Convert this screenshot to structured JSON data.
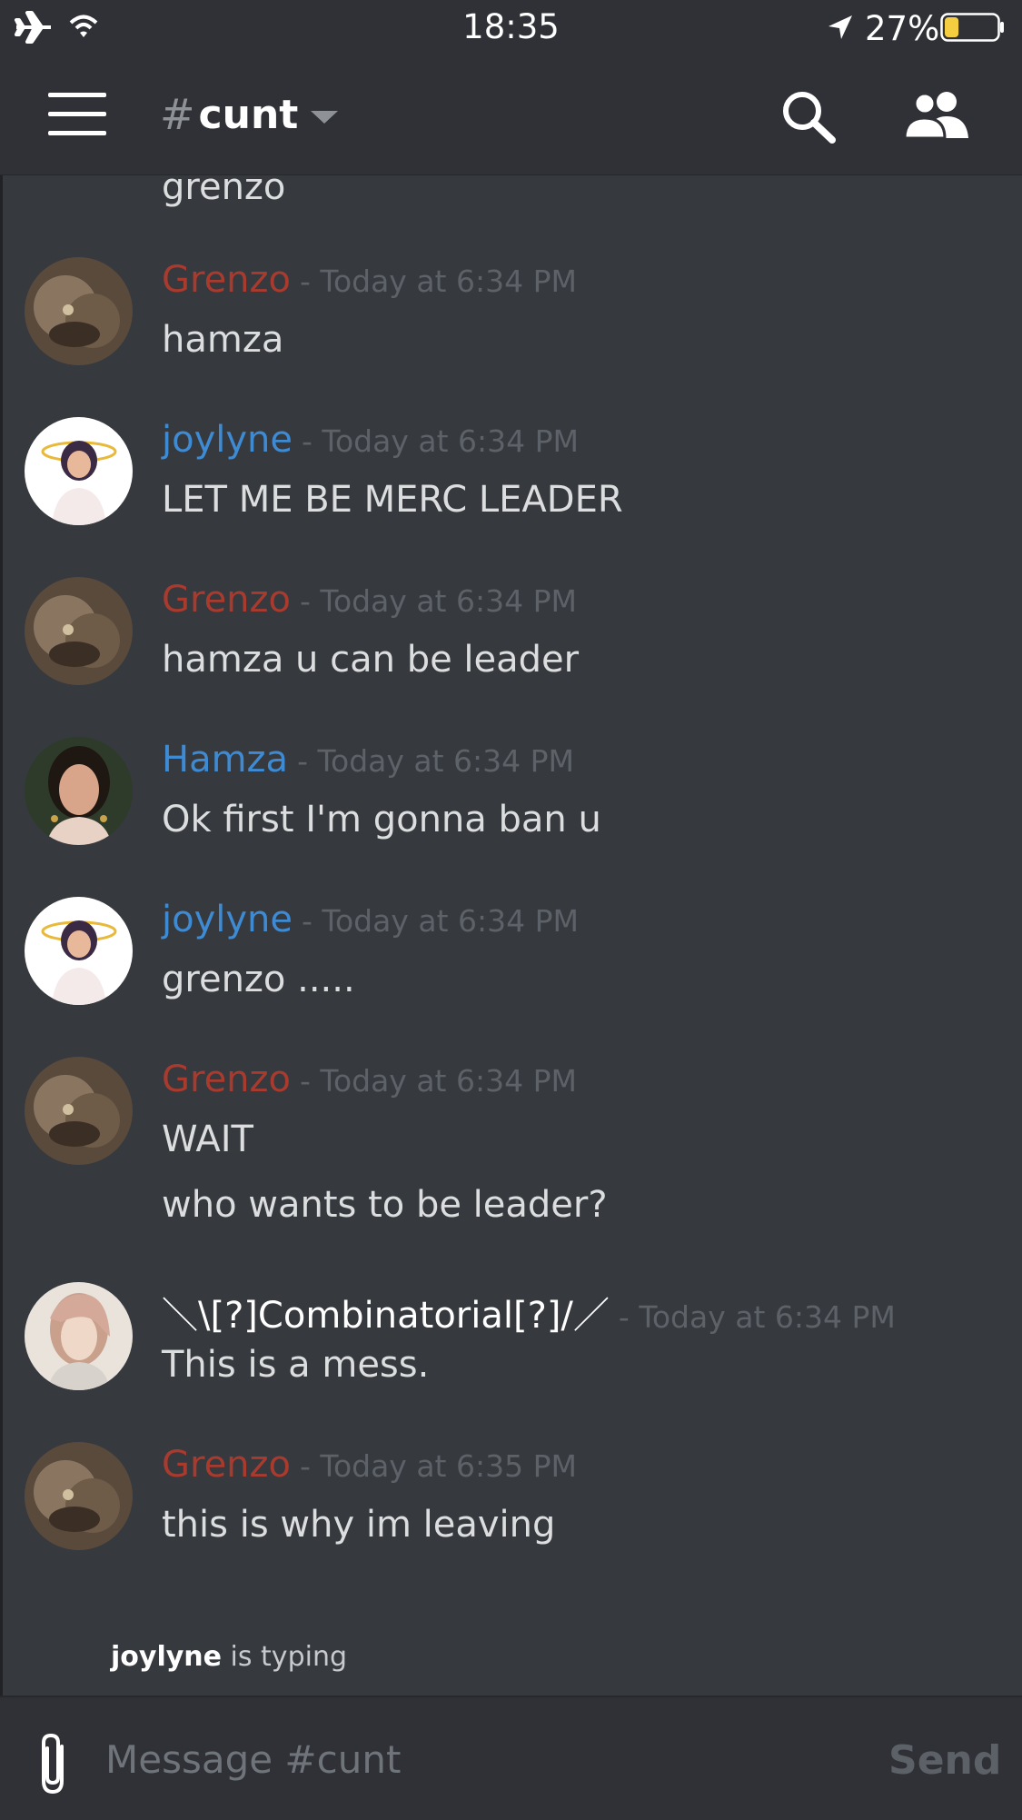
{
  "status_bar": {
    "time": "18:35",
    "battery_percent": "27%",
    "battery_level": 0.27
  },
  "header": {
    "channel_hash": "#",
    "channel_name": "cunt"
  },
  "colors": {
    "background": "#36393e",
    "bars": "#2f3136",
    "author_red": "#a83a2e",
    "author_blue": "#3e8bd3",
    "timestamp": "#5d6168",
    "text": "#dcddde"
  },
  "messages": {
    "partial": {
      "text": "grenzo"
    },
    "m1": {
      "author": "Grenzo",
      "time": "- Today at 6:34 PM",
      "text": "hamza"
    },
    "m2": {
      "author": "joylyne",
      "time": "- Today at 6:34 PM",
      "text": "LET ME BE MERC LEADER"
    },
    "m3": {
      "author": "Grenzo",
      "time": "- Today at 6:34 PM",
      "text": "hamza u can be leader"
    },
    "m4": {
      "author": "Hamza",
      "time": "- Today at 6:34 PM",
      "text": "Ok first I'm gonna ban u"
    },
    "m5": {
      "author": "joylyne",
      "time": "- Today at 6:34 PM",
      "text": "grenzo ....."
    },
    "m6": {
      "author": "Grenzo",
      "time": "- Today at 6:34 PM",
      "text": "WAIT",
      "text2": "who wants to be leader?"
    },
    "m7": {
      "author": "＼\\[?]Combinatorial[?]/／",
      "time": "- Today at 6:34 PM",
      "text": "This is a mess."
    },
    "m8": {
      "author": "Grenzo",
      "time": "- Today at 6:35 PM",
      "text": "this is why im leaving"
    }
  },
  "typing": {
    "user": "joylyne",
    "suffix": "is typing"
  },
  "composer": {
    "placeholder": "Message #cunt",
    "send_label": "Send"
  },
  "icons": [
    "airplane-icon",
    "wifi-icon",
    "location-arrow-icon",
    "battery-icon",
    "hamburger-menu-icon",
    "chevron-down-icon",
    "search-icon",
    "members-icon",
    "paperclip-icon"
  ]
}
